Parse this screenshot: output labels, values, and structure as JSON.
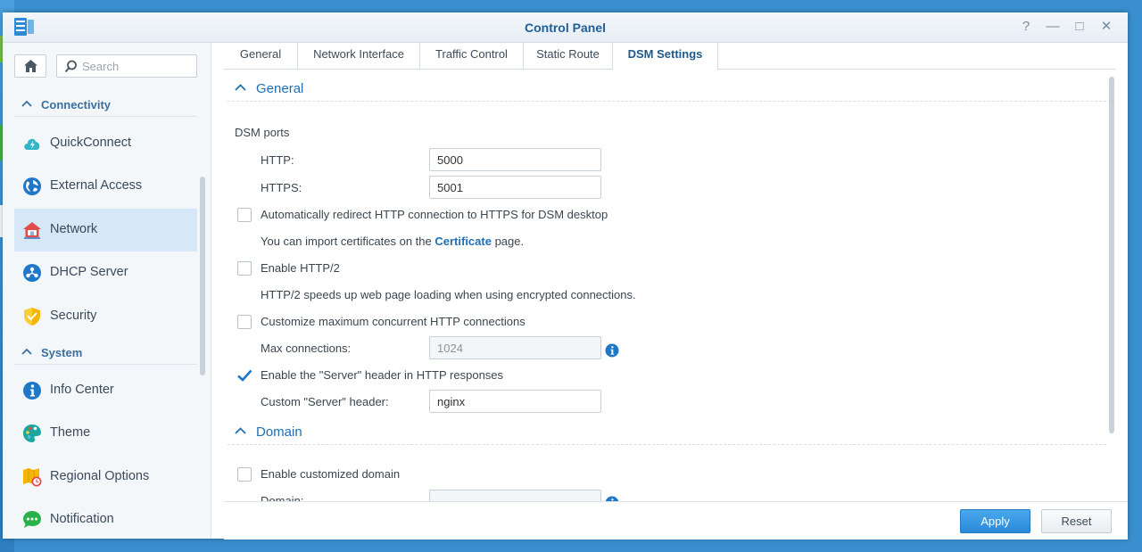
{
  "window": {
    "title": "Control Panel",
    "controls": {
      "help": "?",
      "minimize": "—",
      "maximize": "□",
      "close": "✕"
    }
  },
  "sidebar": {
    "search": {
      "placeholder": "Search",
      "value": ""
    },
    "groups": [
      {
        "label": "Connectivity",
        "items": [
          {
            "label": "QuickConnect",
            "icon": "quickconnect-icon"
          },
          {
            "label": "External Access",
            "icon": "globe-icon"
          },
          {
            "label": "Network",
            "icon": "network-house-icon",
            "active": true
          },
          {
            "label": "DHCP Server",
            "icon": "dhcp-icon"
          },
          {
            "label": "Security",
            "icon": "shield-icon"
          }
        ]
      },
      {
        "label": "System",
        "items": [
          {
            "label": "Info Center",
            "icon": "info-icon"
          },
          {
            "label": "Theme",
            "icon": "palette-icon"
          },
          {
            "label": "Regional Options",
            "icon": "map-clock-icon"
          },
          {
            "label": "Notification",
            "icon": "chat-bubble-icon"
          }
        ]
      }
    ]
  },
  "tabs": [
    {
      "label": "General"
    },
    {
      "label": "Network Interface"
    },
    {
      "label": "Traffic Control"
    },
    {
      "label": "Static Route"
    },
    {
      "label": "DSM Settings",
      "active": true
    }
  ],
  "general": {
    "title": "General",
    "dsm_ports_label": "DSM ports",
    "http_label": "HTTP:",
    "http_value": "5000",
    "https_label": "HTTPS:",
    "https_value": "5001",
    "redirect_label": "Automatically redirect HTTP connection to HTTPS for DSM desktop",
    "redirect_checked": false,
    "cert_note_prefix": "You can import certificates on the",
    "cert_link": "Certificate",
    "cert_note_suffix": "page.",
    "http2_label": "Enable HTTP/2",
    "http2_checked": false,
    "http2_note": "HTTP/2 speeds up web page loading when using encrypted connections.",
    "maxconn_check_label": "Customize maximum concurrent HTTP connections",
    "maxconn_checked": false,
    "maxconn_label": "Max connections:",
    "maxconn_value": "1024",
    "server_header_check_label": "Enable the \"Server\" header in HTTP responses",
    "server_header_checked": true,
    "custom_server_label": "Custom \"Server\" header:",
    "custom_server_value": "nginx"
  },
  "domain": {
    "title": "Domain",
    "enable_label": "Enable customized domain",
    "enable_checked": false,
    "domain_label": "Domain:",
    "domain_value": ""
  },
  "footer": {
    "apply": "Apply",
    "reset": "Reset"
  },
  "colors": {
    "accent": "#1f6fb5",
    "active_nav": "#d6e8f8",
    "primary_button": "#2a8ad9"
  }
}
